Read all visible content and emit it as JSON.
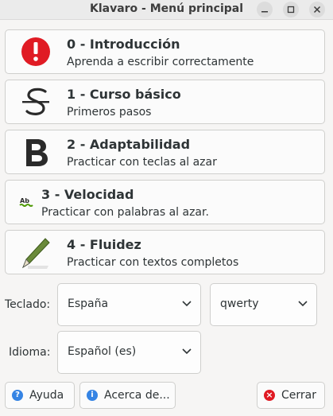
{
  "window": {
    "title": "Klavaro - Menú principal"
  },
  "menu": [
    {
      "title": "0 - Introducción",
      "subtitle": "Aprenda a escribir correctamente",
      "icon": "exclamation-icon"
    },
    {
      "title": "1 - Curso básico",
      "subtitle": "Primeros pasos",
      "icon": "stroked-s-icon"
    },
    {
      "title": "2 - Adaptabilidad",
      "subtitle": "Practicar con teclas al azar",
      "icon": "bold-b-icon"
    },
    {
      "title": "3 - Velocidad",
      "subtitle": "Practicar con palabras al azar.",
      "icon": "ab-keys-icon"
    },
    {
      "title": "4 - Fluidez",
      "subtitle": "Practicar con textos completos",
      "icon": "pen-icon"
    }
  ],
  "settings": {
    "keyboard_label": "Teclado:",
    "keyboard_country": "España",
    "keyboard_layout": "qwerty",
    "language_label": "Idioma:",
    "language": "Español (es)"
  },
  "footer": {
    "help_label": "Ayuda",
    "about_label": "Acerca de...",
    "close_label": "Cerrar"
  },
  "colors": {
    "alert_red": "#e01b24",
    "info_blue": "#3584e4",
    "close_red": "#e01b24"
  }
}
